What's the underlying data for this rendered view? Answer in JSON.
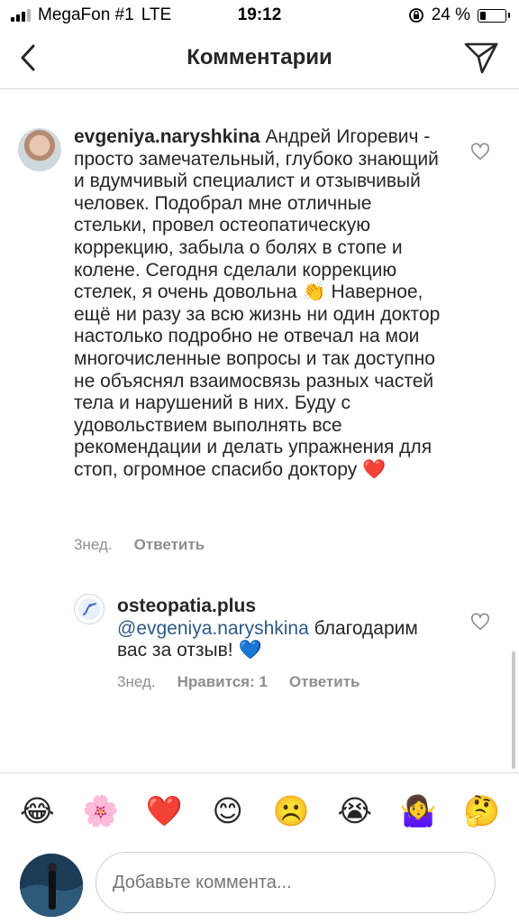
{
  "status_bar": {
    "carrier": "MegaFon #1",
    "network": "LTE",
    "time": "19:12",
    "battery_text": "24 %",
    "battery_level": 0.24
  },
  "header": {
    "title": "Комментарии",
    "back_icon": "chevron-left-icon",
    "send_icon": "paper-plane-icon"
  },
  "comments": [
    {
      "username": "evgeniya.naryshkina",
      "text_part1": "Андрей Игоревич - просто замечательный, глубоко знающий и вдумчивый специалист и отзывчивый человек. Подобрал мне отличные стельки, провел остеопатическую коррекцию, забыла о болях в стопе и колене. Сегодня сделали коррекцию стелек, я очень довольна",
      "emoji1": "👏",
      "text_part2": "Наверное, ещё ни разу за всю жизнь ни один доктор настолько подробно не отвечал на мои многочисленные вопросы и так доступно не объяснял взаимосвязь разных частей тела и нарушений в них. Буду с удовольствием выполнять все рекомендации и делать упражнения для стоп, огромное спасибо доктору",
      "emoji2": "❤️",
      "time": "3нед.",
      "reply_label": "Ответить"
    },
    {
      "username": "osteopatia.plus",
      "mention": "@evgeniya.naryshkina",
      "text": "благодарим вас за отзыв!",
      "emoji": "💙",
      "time": "3нед.",
      "likes_label": "Нравится: 1",
      "reply_label": "Ответить"
    }
  ],
  "emoji_bar": [
    "😂",
    "🌸",
    "❤️",
    "😊",
    "☹️",
    "😭",
    "🤷‍♀️",
    "🤔"
  ],
  "input": {
    "placeholder": "Добавьте коммента..."
  },
  "colors": {
    "mention": "#2b5a86",
    "secondary_text": "#8e8e8e",
    "divider": "#dbdbdb",
    "heart_red": "#e0245e",
    "heart_blue": "#2f7fe0"
  }
}
